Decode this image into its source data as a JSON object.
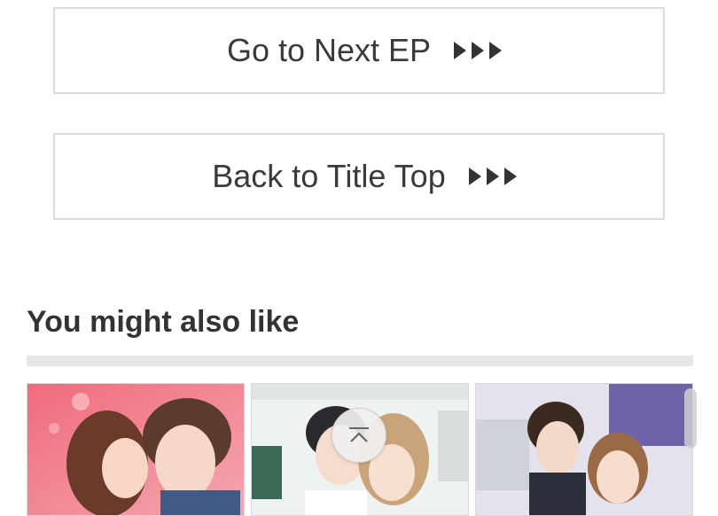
{
  "navigation": {
    "next_label": "Go to Next EP",
    "back_label": "Back to Title Top"
  },
  "recommendations": {
    "title": "You might also like",
    "items": [
      {
        "icon": "manga-cover-thumbnail"
      },
      {
        "icon": "manga-cover-thumbnail"
      },
      {
        "icon": "manga-cover-thumbnail"
      }
    ]
  },
  "scroll_top": {
    "icon": "chevron-up-icon"
  },
  "colors": {
    "text": "#333333",
    "border": "#dcdcdc",
    "divider": "#e6e6e6"
  }
}
